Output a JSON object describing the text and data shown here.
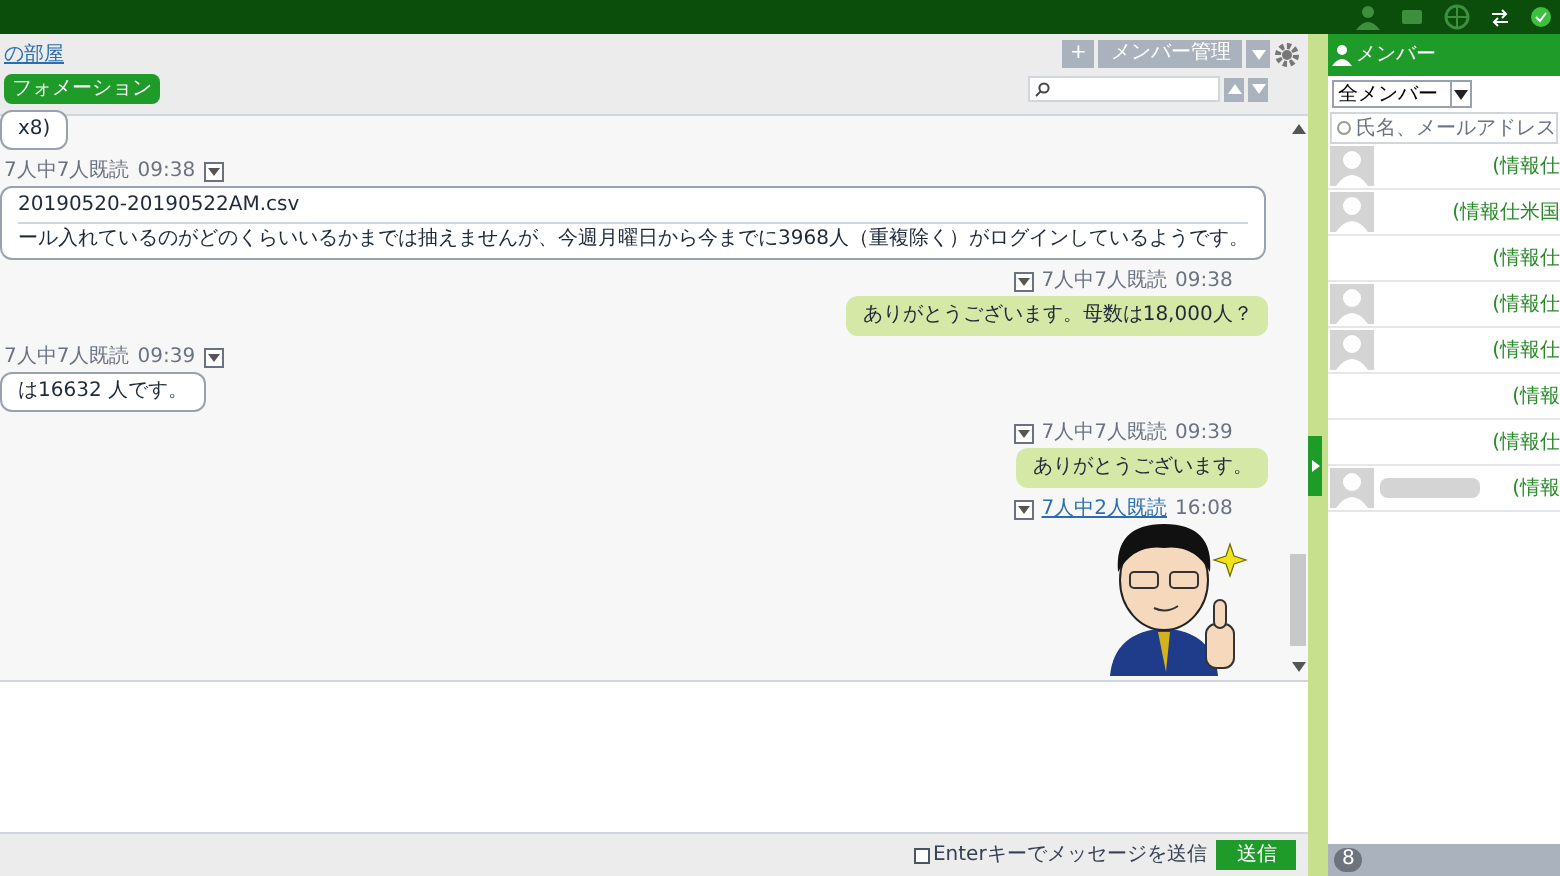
{
  "room": {
    "title": "の部屋",
    "tag": "フォメーション"
  },
  "toolbar": {
    "add": "+",
    "manage": "メンバー管理"
  },
  "messages": [
    {
      "own": false,
      "kind": "text",
      "text": "x8)"
    },
    {
      "own": false,
      "kind": "file",
      "meta": {
        "read": "7人中7人既読",
        "time": "09:38",
        "link": false
      },
      "file": "20190520-20190522AM.csv",
      "text": "ール入れているのがどのくらいいるかまでは抽えませんが、今週月曜日から今までに3968人（重複除く）がログインしているようです。"
    },
    {
      "own": true,
      "kind": "text",
      "meta": {
        "read": "7人中7人既読",
        "time": "09:38",
        "link": false
      },
      "text": "ありがとうございます。母数は18,000人？"
    },
    {
      "own": false,
      "kind": "text",
      "meta": {
        "read": "7人中7人既読",
        "time": "09:39",
        "link": false
      },
      "text": "は16632 人です。"
    },
    {
      "own": true,
      "kind": "text",
      "meta": {
        "read": "7人中7人既読",
        "time": "09:39",
        "link": false
      },
      "text": "ありがとうございます。"
    },
    {
      "own": true,
      "kind": "sticker",
      "meta": {
        "read": "7人中2人既読",
        "time": "16:08",
        "link": true
      }
    }
  ],
  "composer": {
    "enter_label": "Enterキーでメッセージを送信",
    "checked": false,
    "send": "送信"
  },
  "members": {
    "title": "メンバー",
    "filter": "全メンバー",
    "search_placeholder": "氏名、メールアドレス",
    "count": "8",
    "items": [
      {
        "avatar": true,
        "name_hidden": false,
        "dept": "(情報仕"
      },
      {
        "avatar": true,
        "name_hidden": false,
        "dept": "(情報仕米国"
      },
      {
        "avatar": false,
        "name_hidden": false,
        "dept": "(情報仕"
      },
      {
        "avatar": true,
        "name_hidden": false,
        "dept": "(情報仕"
      },
      {
        "avatar": true,
        "name_hidden": false,
        "dept": "(情報仕"
      },
      {
        "avatar": false,
        "name_hidden": false,
        "dept": "(情報"
      },
      {
        "avatar": false,
        "name_hidden": false,
        "dept": "(情報仕"
      },
      {
        "avatar": true,
        "name_hidden": true,
        "dept": "(情報"
      }
    ]
  }
}
